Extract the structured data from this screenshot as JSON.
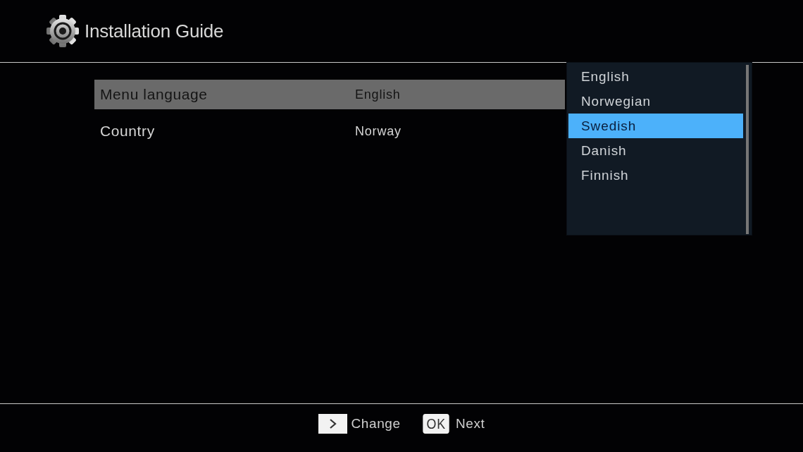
{
  "header": {
    "title": "Installation Guide"
  },
  "settings": [
    {
      "label": "Menu language",
      "value": "English",
      "selected": true
    },
    {
      "label": "Country",
      "value": "Norway",
      "selected": false
    }
  ],
  "dropdown": {
    "options": [
      {
        "label": "English",
        "selected": false
      },
      {
        "label": "Norwegian",
        "selected": false
      },
      {
        "label": "Swedish",
        "selected": true
      },
      {
        "label": "Danish",
        "selected": false
      },
      {
        "label": "Finnish",
        "selected": false
      }
    ]
  },
  "footer_hints": [
    {
      "kind": "arrow",
      "label": "Change"
    },
    {
      "kind": "key",
      "key": "OK",
      "label": "Next"
    }
  ]
}
